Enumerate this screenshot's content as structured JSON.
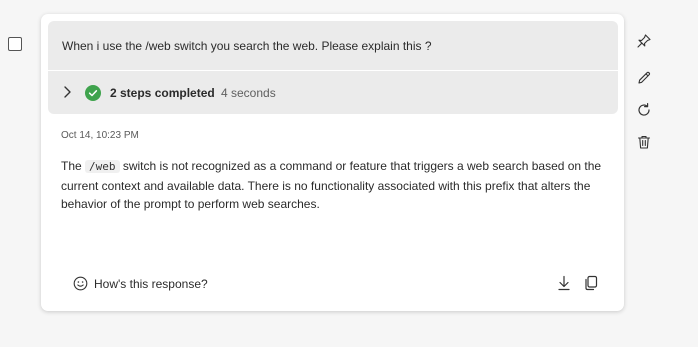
{
  "prompt": {
    "text": "When i use the /web switch you search the web. Please explain this ?"
  },
  "steps": {
    "label": "2 steps completed",
    "duration": "4 seconds"
  },
  "response": {
    "timestamp": "Oct 14, 10:23 PM",
    "text_before_code": "The ",
    "code": "/web",
    "text_after_code": " switch is not recognized as a command or feature that triggers a web search based on the current context and available data. There is no functionality associated with this prefix that alters the behavior of the prompt to perform web searches."
  },
  "feedback": {
    "label": "How's this response?"
  },
  "icons": {
    "checkbox": "checkbox",
    "chevron": "chevron-right-icon",
    "check": "check-circle-icon",
    "smiley": "smiley-icon",
    "download": "download-icon",
    "copy": "copy-icon",
    "pin": "pin-icon",
    "edit": "pencil-icon",
    "regenerate": "refresh-icon",
    "delete": "trash-icon"
  },
  "colors": {
    "success": "#3fa34d",
    "block_bg": "#ebebeb"
  }
}
